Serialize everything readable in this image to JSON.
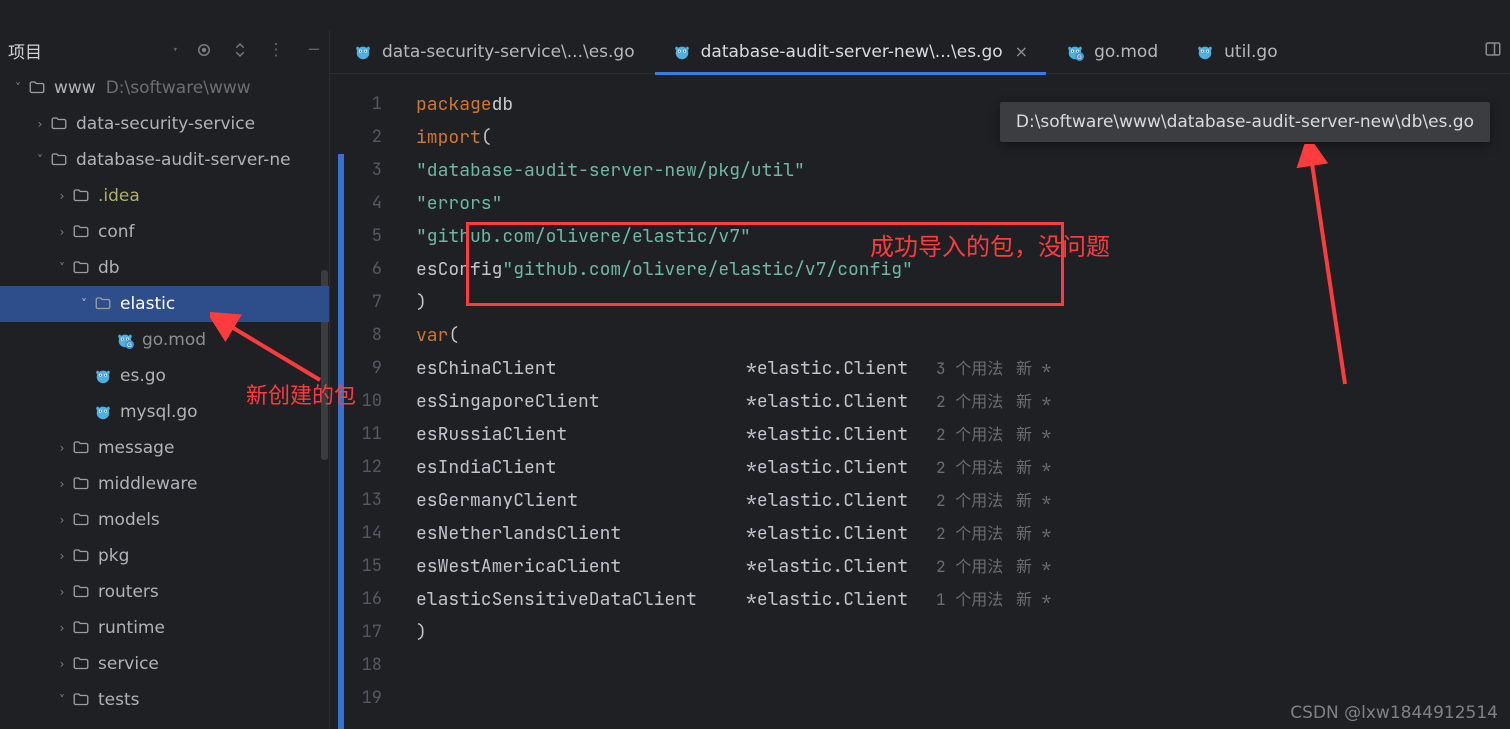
{
  "sidebar": {
    "title": "项目",
    "root": {
      "name": "www",
      "path": "D:\\software\\www"
    },
    "tree": [
      {
        "depth": 0,
        "kind": "folder",
        "arrow": "down",
        "name": "www",
        "extra": "D:\\software\\www"
      },
      {
        "depth": 1,
        "kind": "folder",
        "arrow": "right",
        "name": "data-security-service"
      },
      {
        "depth": 1,
        "kind": "folder",
        "arrow": "down",
        "name": "database-audit-server-new",
        "truncated": true
      },
      {
        "depth": 2,
        "kind": "folder",
        "arrow": "right",
        "name": ".idea",
        "yellow": true
      },
      {
        "depth": 2,
        "kind": "folder",
        "arrow": "right",
        "name": "conf"
      },
      {
        "depth": 2,
        "kind": "folder",
        "arrow": "down",
        "name": "db"
      },
      {
        "depth": 3,
        "kind": "folder",
        "arrow": "down",
        "name": "elastic",
        "selected": true
      },
      {
        "depth": 4,
        "kind": "go-pkg",
        "arrow": "",
        "name": "go.mod",
        "muted": true
      },
      {
        "depth": 3,
        "kind": "go",
        "arrow": "",
        "name": "es.go"
      },
      {
        "depth": 3,
        "kind": "go",
        "arrow": "",
        "name": "mysql.go"
      },
      {
        "depth": 2,
        "kind": "folder",
        "arrow": "right",
        "name": "message"
      },
      {
        "depth": 2,
        "kind": "folder",
        "arrow": "right",
        "name": "middleware"
      },
      {
        "depth": 2,
        "kind": "folder",
        "arrow": "right",
        "name": "models"
      },
      {
        "depth": 2,
        "kind": "folder",
        "arrow": "right",
        "name": "pkg"
      },
      {
        "depth": 2,
        "kind": "folder",
        "arrow": "right",
        "name": "routers"
      },
      {
        "depth": 2,
        "kind": "folder",
        "arrow": "right",
        "name": "runtime"
      },
      {
        "depth": 2,
        "kind": "folder",
        "arrow": "right",
        "name": "service"
      },
      {
        "depth": 2,
        "kind": "folder",
        "arrow": "down",
        "name": "tests"
      }
    ]
  },
  "tabs": [
    {
      "icon": "go",
      "label": "data-security-service\\...\\es.go",
      "active": false,
      "closeable": false
    },
    {
      "icon": "go",
      "label": "database-audit-server-new\\...\\es.go",
      "active": true,
      "closeable": true
    },
    {
      "icon": "go-pkg",
      "label": "go.mod",
      "active": false,
      "closeable": false
    },
    {
      "icon": "go",
      "label": "util.go",
      "active": false,
      "closeable": false
    }
  ],
  "tooltip_path": "D:\\software\\www\\database-audit-server-new\\db\\es.go",
  "code": {
    "lines": [
      {
        "n": 1,
        "html": "<span class='kw'>package</span> <span class='pkg'>db</span>"
      },
      {
        "n": 2,
        "html": ""
      },
      {
        "n": 3,
        "html": "<span class='kw'>import</span> <span class='punc'>(</span>"
      },
      {
        "n": 4,
        "html": "    <span class='str'>\"database-audit-server-new/pkg/util\"</span>"
      },
      {
        "n": 5,
        "html": "    <span class='str'>\"errors\"</span>"
      },
      {
        "n": 6,
        "html": "    <span class='str'>\"github.com/olivere/elastic/v7\"</span>"
      },
      {
        "n": 7,
        "html": "    <span class='ident'>esConfig</span> <span class='str'>\"github.com/olivere/elastic/v7/config\"</span>"
      },
      {
        "n": 8,
        "html": "<span class='punc'>)</span>"
      },
      {
        "n": 9,
        "html": ""
      },
      {
        "n": 10,
        "html": "<span class='kw'>var</span> <span class='punc'>(</span>"
      }
    ],
    "vars": [
      {
        "n": 11,
        "name": "esChinaClient",
        "type": "*elastic.Client",
        "usage": "3 个用法",
        "new": "新 *"
      },
      {
        "n": 12,
        "name": "esSingaporeClient",
        "type": "*elastic.Client",
        "usage": "2 个用法",
        "new": "新 *"
      },
      {
        "n": 13,
        "name": "esRussiaClient",
        "type": "*elastic.Client",
        "usage": "2 个用法",
        "new": "新 *"
      },
      {
        "n": 14,
        "name": "esIndiaClient",
        "type": "*elastic.Client",
        "usage": "2 个用法",
        "new": "新 *"
      },
      {
        "n": 15,
        "name": "esGermanyClient",
        "type": "*elastic.Client",
        "usage": "2 个用法",
        "new": "新 *"
      },
      {
        "n": 16,
        "name": "esNetherlandsClient",
        "type": "*elastic.Client",
        "usage": "2 个用法",
        "new": "新 *"
      },
      {
        "n": 17,
        "name": "esWestAmericaClient",
        "type": "*elastic.Client",
        "usage": "2 个用法",
        "new": "新 *"
      },
      {
        "n": 18,
        "name": "elasticSensitiveDataClient",
        "type": "*elastic.Client",
        "usage": "1 个用法",
        "new": "新 *"
      }
    ],
    "close_line": {
      "n": 19,
      "html": "<span class='punc'>)</span>"
    }
  },
  "annotations": {
    "import_ok": "成功导入的包，没问题",
    "new_pkg": "新创建的包"
  },
  "watermark": "CSDN @lxw1844912514"
}
